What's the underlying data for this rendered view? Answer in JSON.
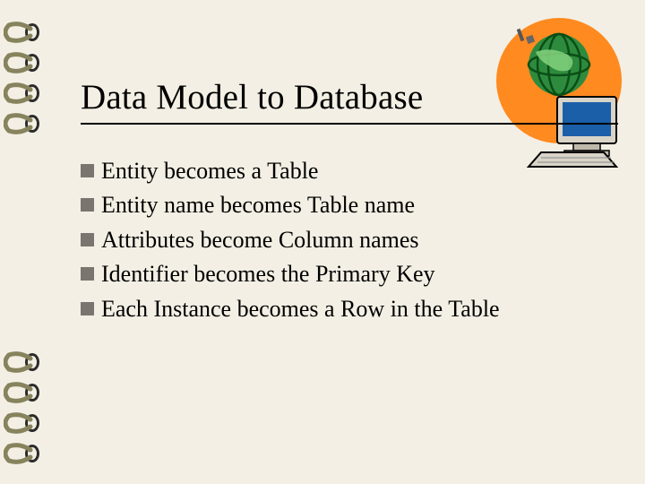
{
  "title": "Data Model to Database",
  "bullets": [
    "Entity becomes a Table",
    "Entity name becomes Table name",
    "Attributes become Column names",
    "Identifier becomes the Primary Key",
    "Each Instance becomes a Row in the Table"
  ]
}
